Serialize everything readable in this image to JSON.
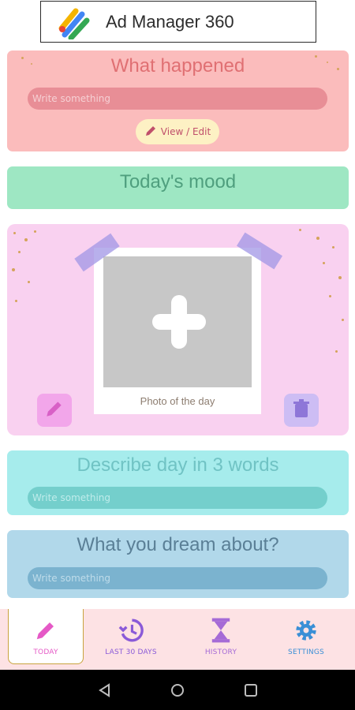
{
  "ad": {
    "title": "Ad Manager 360"
  },
  "happened": {
    "title": "What happened",
    "placeholder": "Write something",
    "view_edit_label": "View / Edit"
  },
  "mood": {
    "title": "Today's mood"
  },
  "photo": {
    "caption": "Photo of the day"
  },
  "words": {
    "title": "Describe day in 3 words",
    "placeholder": "Write something"
  },
  "dream": {
    "title": "What you dream about?",
    "placeholder": "Write something"
  },
  "nav": {
    "items": [
      {
        "label": "TODAY",
        "icon": "pencil-icon",
        "color": "#e559c6",
        "active": true
      },
      {
        "label": "LAST 30 DAYS",
        "icon": "history-icon",
        "color": "#8a5ad8"
      },
      {
        "label": "HISTORY",
        "icon": "hourglass-icon",
        "color": "#a56ad6"
      },
      {
        "label": "SETTINGS",
        "icon": "gear-icon",
        "color": "#3a8fd6"
      }
    ]
  },
  "colors": {
    "happened_bg": "#fbbcbc",
    "mood_bg": "#9ee7c3",
    "photo_bg": "#f9d1f0",
    "words_bg": "#a6ecec",
    "dream_bg": "#b1d8ea",
    "nav_bg": "#fde2e4"
  }
}
